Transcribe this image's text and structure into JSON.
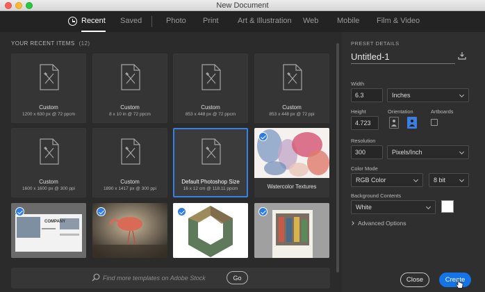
{
  "window": {
    "title": "New Document"
  },
  "tabs": [
    {
      "label": "Recent",
      "active": true
    },
    {
      "label": "Saved"
    },
    {
      "label": "Photo"
    },
    {
      "label": "Print"
    },
    {
      "label": "Art & Illustration"
    },
    {
      "label": "Web"
    },
    {
      "label": "Mobile"
    },
    {
      "label": "Film & Video"
    }
  ],
  "recent": {
    "title": "YOUR RECENT ITEMS",
    "count": "(12)",
    "items": [
      {
        "name": "Custom",
        "meta": "1200 x 630 px @ 72 ppcm"
      },
      {
        "name": "Custom",
        "meta": "8 x 10 in @ 72 ppcm"
      },
      {
        "name": "Custom",
        "meta": "853 x 448 px @ 72 ppcm"
      },
      {
        "name": "Custom",
        "meta": "853 x 448 px @ 72 ppi"
      },
      {
        "name": "Custom",
        "meta": "1600 x 1600 px @ 300 ppi"
      },
      {
        "name": "Custom",
        "meta": "1890 x 1417 px @ 300 ppi"
      },
      {
        "name": "Default Photoshop Size",
        "meta": "16 x 12 cm @ 118.11 ppcm"
      },
      {
        "name": "Watercolor Textures"
      }
    ]
  },
  "images": {
    "company_text": "COMPANY"
  },
  "search": {
    "placeholder": "Find more templates on Adobe Stock",
    "go_label": "Go"
  },
  "preset": {
    "title": "PRESET DETAILS",
    "name": "Untitled-1",
    "width_label": "Width",
    "width_value": "6.3",
    "width_unit": "Inches",
    "height_label": "Height",
    "height_value": "4.723",
    "orientation_label": "Orientation",
    "artboards_label": "Artboards",
    "resolution_label": "Resolution",
    "resolution_value": "300",
    "resolution_unit": "Pixels/Inch",
    "color_mode_label": "Color Mode",
    "color_mode_value": "RGB Color",
    "bit_depth": "8 bit",
    "background_label": "Background Contents",
    "background_value": "White",
    "advanced_label": "Advanced Options"
  },
  "actions": {
    "close_label": "Close",
    "create_label": "Create"
  },
  "colors": {
    "accent": "#1473e6",
    "selection": "#3680e6"
  }
}
